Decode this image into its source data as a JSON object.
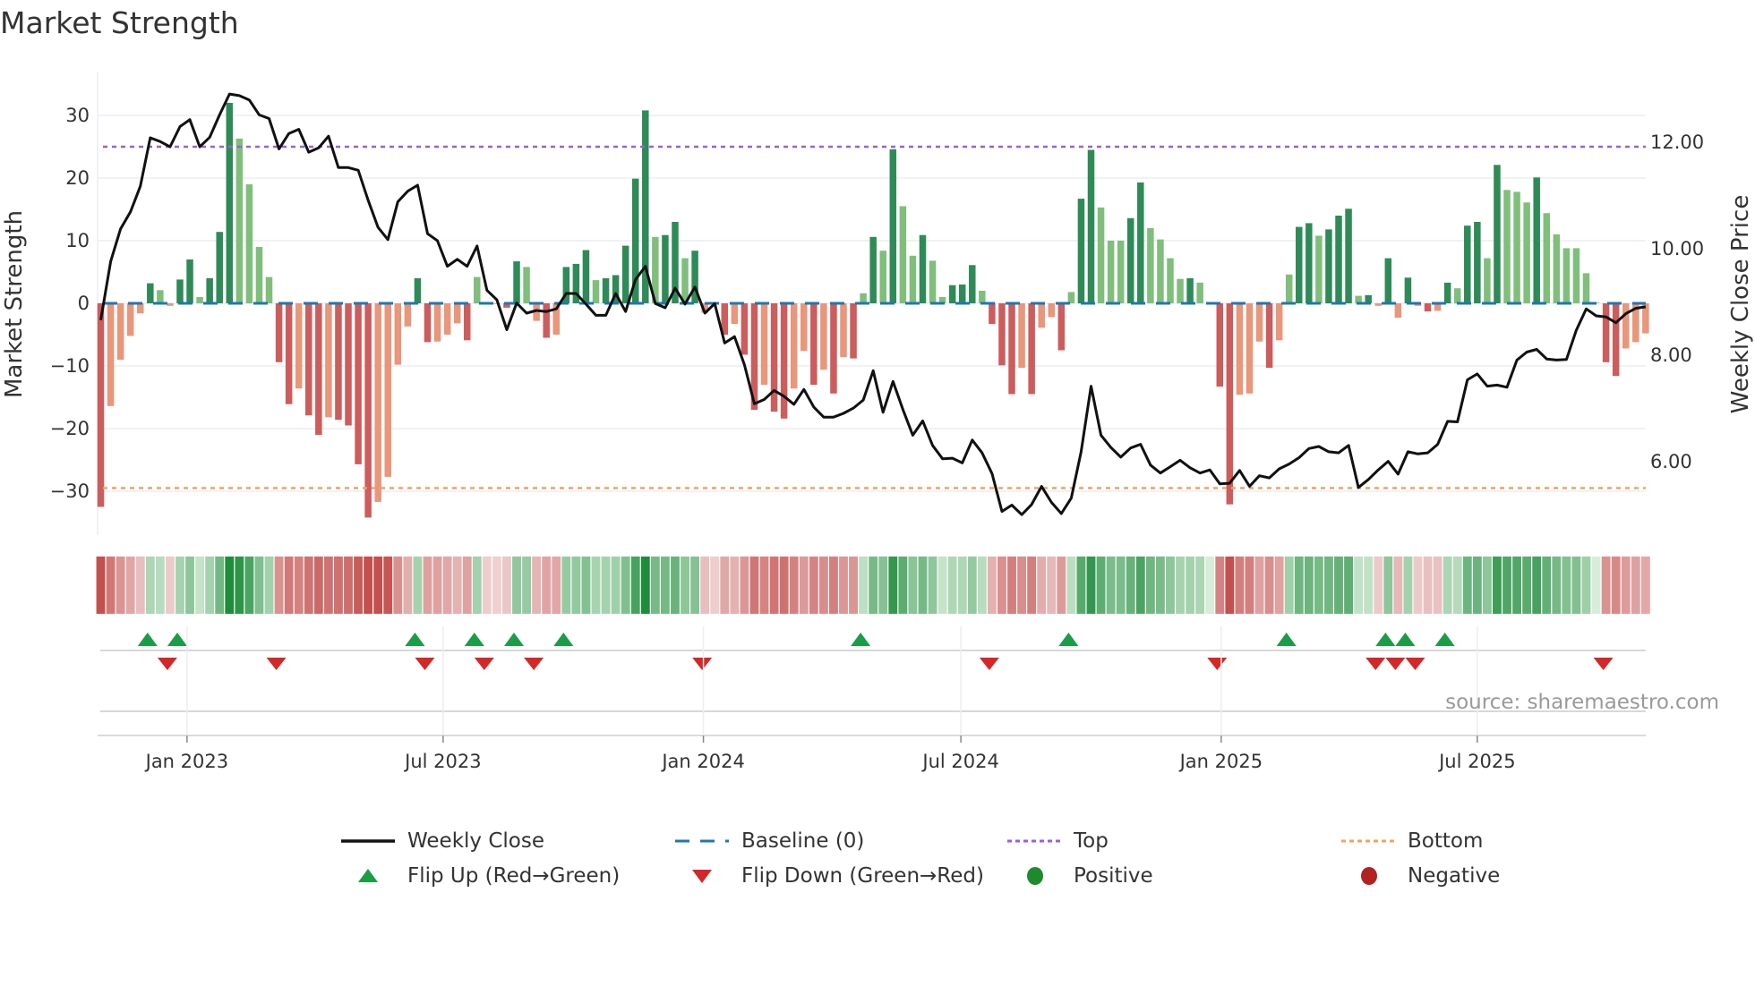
{
  "title": "Market Strength",
  "source_note": "source: sharemaestro.com",
  "colors": {
    "strong_positive": "#2e8b57",
    "weak_positive": "#7fbf7b",
    "strong_negative": "#cd5c5c",
    "weak_negative": "#e9967a",
    "baseline": "#1f77b4",
    "top": "#9b5de5",
    "bottom": "#f4a261",
    "close": "#111111",
    "flip_up": "#1a9e45",
    "flip_down": "#d62728",
    "positive": "#1e8a2e",
    "negative": "#b22222"
  },
  "chart_data": {
    "type": "bar",
    "title": "Market Strength",
    "ylabel": "Market Strength",
    "y2label": "Weekly Close Price",
    "ylim": [
      -37,
      37
    ],
    "y2lim": [
      4.6,
      13.7
    ],
    "yticks": [
      30,
      20,
      10,
      0,
      -10,
      -20,
      -30
    ],
    "ytick_labels": [
      "30",
      "20",
      "10",
      "0",
      "−10",
      "−20",
      "−30"
    ],
    "y2ticks": [
      12,
      10,
      8,
      6
    ],
    "y2tick_labels": [
      "12.00",
      "10.00",
      "8.00",
      "6.00"
    ],
    "x_start": "2022-11-01",
    "x_step_days": 7,
    "xticks": [
      {
        "date": "2023-01-01",
        "label": "Jan 2023"
      },
      {
        "date": "2023-07-01",
        "label": "Jul 2023"
      },
      {
        "date": "2024-01-01",
        "label": "Jan 2024"
      },
      {
        "date": "2024-07-01",
        "label": "Jul 2024"
      },
      {
        "date": "2025-01-01",
        "label": "Jan 2025"
      },
      {
        "date": "2025-07-01",
        "label": "Jul 2025"
      }
    ],
    "top_level": 25,
    "bottom_level": -29.5,
    "baseline": 0,
    "grid": true,
    "legend_position": "bottom",
    "strength": [
      -32.5,
      -16.4,
      -9,
      -5.2,
      -1.6,
      3.2,
      2.1,
      -0.4,
      3.8,
      7,
      1,
      4,
      11.4,
      32,
      26.3,
      19,
      9,
      4.2,
      -9.4,
      -16.1,
      -13.6,
      -17.9,
      -21,
      -18.2,
      -18.6,
      -19.5,
      -25.7,
      -34.2,
      -31.7,
      -27.7,
      -9.8,
      -3.7,
      4,
      -6.2,
      -6.1,
      -5,
      -3.2,
      -5.9,
      4.2,
      -0.2,
      -0.1,
      -0.7,
      6.7,
      5.8,
      -2.8,
      -5.5,
      -5,
      5.8,
      6.3,
      8.5,
      3.7,
      4,
      4.5,
      9.2,
      19.9,
      30.8,
      10.6,
      10.9,
      13,
      7.2,
      8.4,
      -1.5,
      -0.2,
      -5,
      -3.3,
      -8.2,
      -17,
      -13,
      -17.3,
      -18.4,
      -13.6,
      -7.6,
      -13,
      -10.6,
      -14.4,
      -8.6,
      -8.8,
      1.6,
      10.6,
      8.4,
      24.6,
      15.5,
      7.6,
      10.9,
      6.8,
      1,
      2.9,
      3.0,
      6.1,
      2,
      -3.3,
      -9.9,
      -14.5,
      -10.3,
      -14.5,
      -3.9,
      -2.2,
      -7.5,
      1.8,
      16.7,
      24.5,
      15.3,
      10,
      10,
      13.6,
      19.3,
      12,
      10.2,
      7.2,
      3.9,
      4,
      3.3,
      0.1,
      -13.3,
      -32.1,
      -14.6,
      -14.4,
      -6.1,
      -10.3,
      -5.9,
      4.6,
      12.2,
      12.8,
      10.8,
      11.8,
      14,
      15.1,
      1.2,
      1.3,
      -0.4,
      7.2,
      -2.3,
      4.1,
      -0.4,
      -1.3,
      -1.2,
      3.3,
      2.4,
      12.4,
      13,
      7.2,
      22.1,
      18.1,
      17.8,
      16.1,
      20.1,
      14.4,
      11,
      8.8,
      8.8,
      4.8,
      0.1,
      -9.4,
      -11.6,
      -7.2,
      -6.2,
      -4.8
    ],
    "weekly_close": [
      8.66,
      9.76,
      10.37,
      10.69,
      11.17,
      12.08,
      12.01,
      11.91,
      12.29,
      12.42,
      11.91,
      12.09,
      12.51,
      12.9,
      12.87,
      12.79,
      12.51,
      12.44,
      11.87,
      12.16,
      12.24,
      11.81,
      11.89,
      12.11,
      11.52,
      11.52,
      11.47,
      10.91,
      10.4,
      10.17,
      10.88,
      11.08,
      11.19,
      10.28,
      10.15,
      9.67,
      9.8,
      9.67,
      10.05,
      9.22,
      9.04,
      8.48,
      8.98,
      8.79,
      8.84,
      8.82,
      8.87,
      9.16,
      9.16,
      8.96,
      8.75,
      8.75,
      9.16,
      8.82,
      9.42,
      9.67,
      8.97,
      8.89,
      9.26,
      8.96,
      9.28,
      8.79,
      8.97,
      8.23,
      8.35,
      7.82,
      7.09,
      7.17,
      7.34,
      7.23,
      7.08,
      7.36,
      7.03,
      6.84,
      6.84,
      6.91,
      7.01,
      7.16,
      7.71,
      6.93,
      7.51,
      6.98,
      6.5,
      6.77,
      6.31,
      6.06,
      6.07,
      5.98,
      6.41,
      6.17,
      5.78,
      5.07,
      5.19,
      5.01,
      5.2,
      5.54,
      5.24,
      5.03,
      5.32,
      6.19,
      7.42,
      6.5,
      6.27,
      6.09,
      6.26,
      6.33,
      5.94,
      5.79,
      5.91,
      6.03,
      5.89,
      5.79,
      5.85,
      5.59,
      5.6,
      5.84,
      5.54,
      5.74,
      5.7,
      5.87,
      5.96,
      6.08,
      6.25,
      6.29,
      6.19,
      6.17,
      6.31,
      5.52,
      5.67,
      5.85,
      6.01,
      5.77,
      6.19,
      6.15,
      6.17,
      6.33,
      6.76,
      6.75,
      7.54,
      7.65,
      7.42,
      7.44,
      7.4,
      7.91,
      8.06,
      8.11,
      7.93,
      7.91,
      7.92,
      8.47,
      8.87,
      8.74,
      8.72,
      8.61,
      8.78,
      8.88,
      8.91
    ],
    "flip_up_weeks": [
      5,
      8,
      32,
      38,
      42,
      47,
      77,
      98,
      120,
      130,
      132,
      136
    ],
    "flip_down_weeks": [
      7,
      18,
      33,
      39,
      44,
      61,
      90,
      113,
      129,
      131,
      133,
      152
    ]
  },
  "legend": {
    "weekly_close": "Weekly Close",
    "baseline": "Baseline (0)",
    "top": "Top",
    "bottom": "Bottom",
    "flip_up": "Flip Up (Red→Green)",
    "flip_down": "Flip Down (Green→Red)",
    "positive": "Positive",
    "negative": "Negative"
  }
}
